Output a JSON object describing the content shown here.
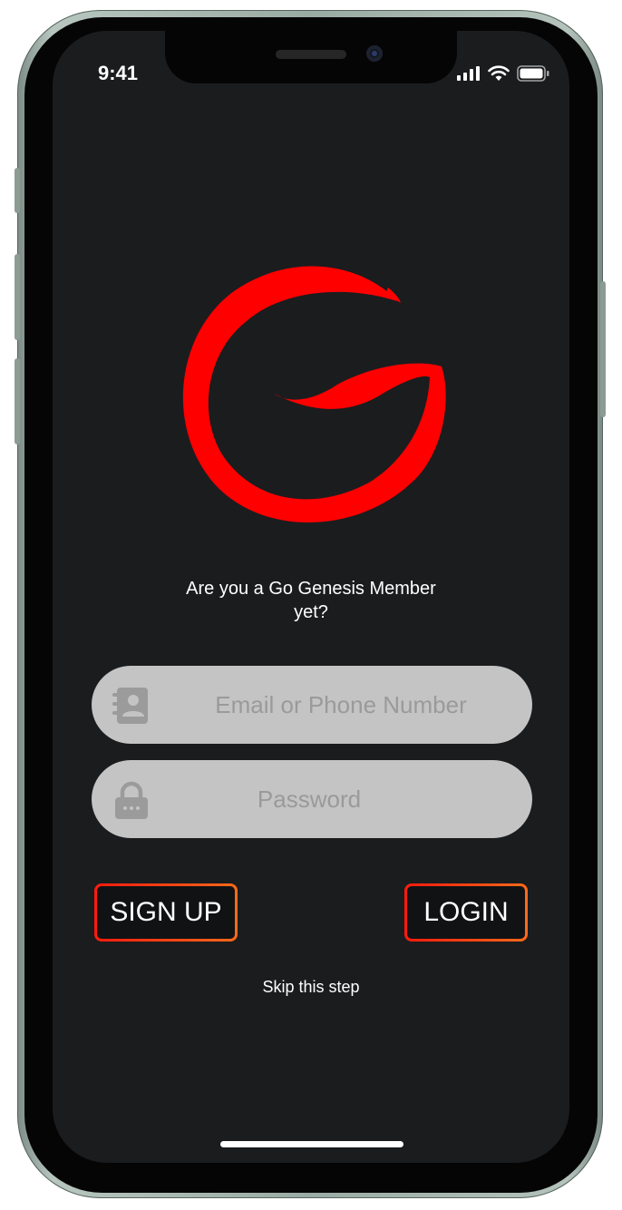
{
  "status_bar": {
    "time": "9:41"
  },
  "prompt": {
    "line1": "Are you a Go Genesis Member",
    "line2": "yet?"
  },
  "email_field": {
    "placeholder": "Email or Phone Number",
    "value": ""
  },
  "password_field": {
    "placeholder": "Password",
    "value": ""
  },
  "buttons": {
    "signup": "SIGN UP",
    "login": "LOGIN"
  },
  "skip_link": "Skip this step",
  "colors": {
    "brand_red": "#ff0000",
    "screen_bg": "#1b1c1e",
    "field_bg": "#c4c4c4",
    "border_gradient_start": "#ff1a0d",
    "border_gradient_end": "#ff6a1a"
  },
  "icons": {
    "logo": "go-genesis-logo",
    "email": "contact-card-icon",
    "password": "lock-icon"
  }
}
